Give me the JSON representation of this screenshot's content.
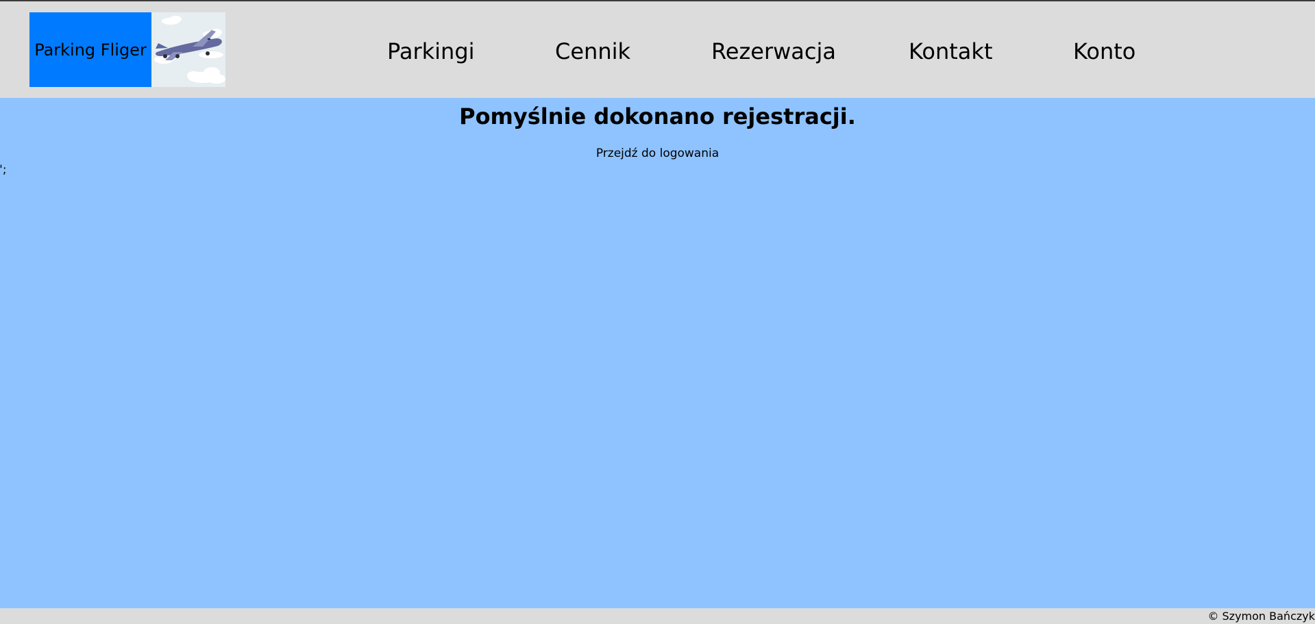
{
  "header": {
    "logo_text": "Parking Fliger",
    "logo_image": "airplane-illustration",
    "nav": {
      "parkingi": "Parkingi",
      "cennik": "Cennik",
      "rezerwacja": "Rezerwacja",
      "kontakt": "Kontakt",
      "konto": "Konto"
    }
  },
  "main": {
    "title": "Pomyślnie dokonano rejestracji.",
    "login_link": "Przejdź do logowania",
    "stray_text": "\";"
  },
  "footer": {
    "copyright": "© Szymon Bańczyk"
  },
  "colors": {
    "header_bg": "#dcdcdc",
    "content_bg": "#8ec3ff",
    "logo_bg": "#007bff"
  }
}
